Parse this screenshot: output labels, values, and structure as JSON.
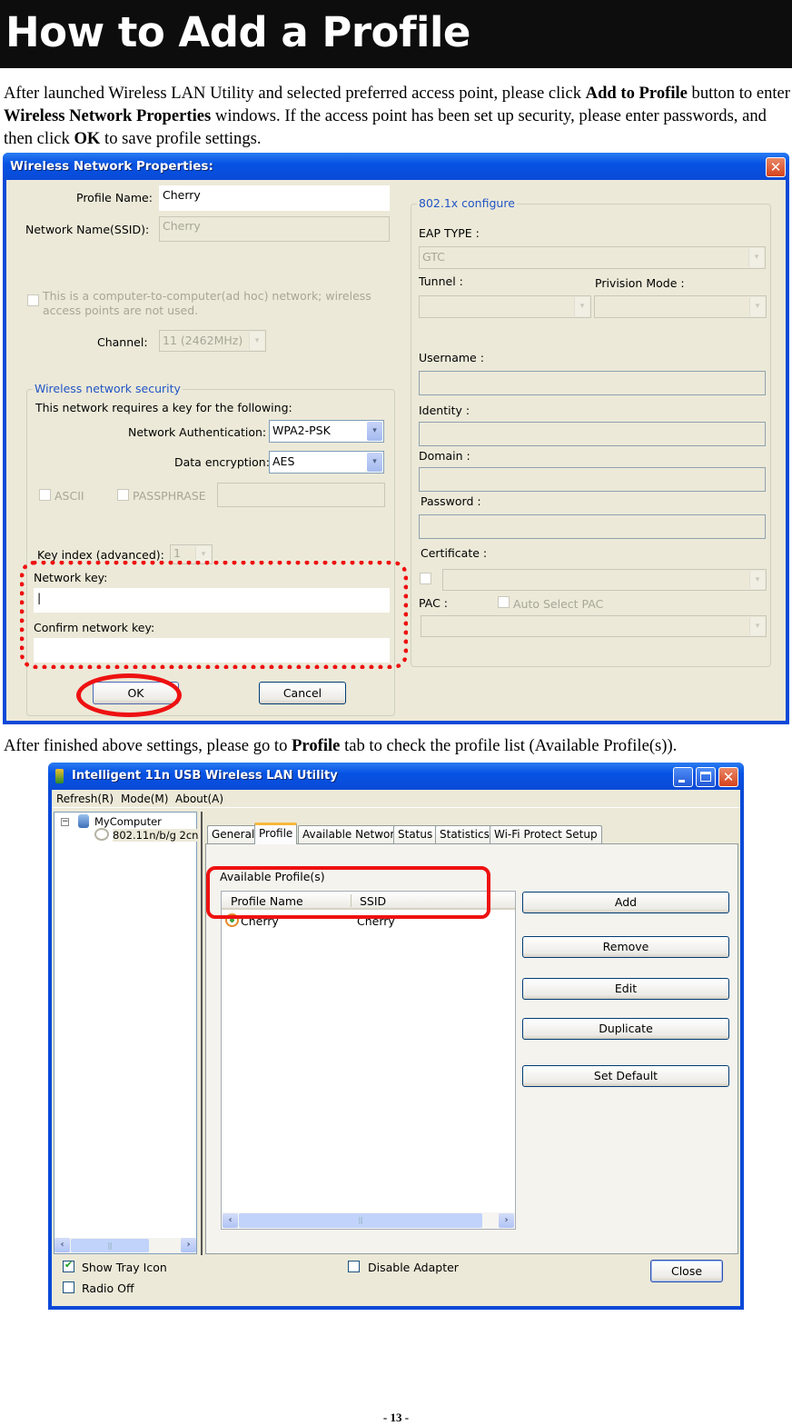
{
  "page": {
    "heading": "How to Add a Profile",
    "intro": {
      "t1": "After launched Wireless LAN Utility and selected preferred access point, please click ",
      "b1": "Add to Profile",
      "t2": " button to enter ",
      "b2": "Wireless Network Properties",
      "t3": " windows. If the access point has been set up security, please enter passwords, and then click ",
      "b3": "OK",
      "t4": " to save profile settings."
    },
    "second": {
      "t1": "After finished above settings, please go to ",
      "b1": "Profile",
      "t2": " tab to check the profile list (Available Profile(s))."
    },
    "page_number": "- 13 -"
  },
  "dialog1": {
    "title": "Wireless Network Properties:",
    "close_glyph": "✕",
    "profile_name_label": "Profile Name:",
    "profile_name_value": "Cherry",
    "ssid_label": "Network Name(SSID):",
    "ssid_value": "Cherry",
    "adhoc_label_line1": "This is a computer-to-computer(ad hoc) network; wireless",
    "adhoc_label_line2": "access points are not used.",
    "channel_label": "Channel:",
    "channel_value": "11 (2462MHz)",
    "security_group": {
      "title": "Wireless network security",
      "requires_text": "This network requires a key for the following:",
      "auth_label": "Network Authentication:",
      "auth_value": "WPA2-PSK",
      "enc_label": "Data encryption:",
      "enc_value": "AES",
      "ascii_label": "ASCII",
      "passphrase_label": "PASSPHRASE",
      "passphrase_value": "",
      "key_index_label": "Key index (advanced):",
      "key_index_value": "1",
      "network_key_label": "Network key:",
      "network_key_value": "|",
      "confirm_key_label": "Confirm network key:",
      "confirm_key_value": ""
    },
    "dot1x_group": {
      "title": "802.1x configure",
      "eap_label": "EAP TYPE :",
      "eap_value": "GTC",
      "tunnel_label": "Tunnel :",
      "tunnel_value": "",
      "provision_label": "Privision Mode :",
      "provision_value": "",
      "username_label": "Username :",
      "identity_label": "Identity :",
      "domain_label": "Domain :",
      "password_label": "Password :",
      "certificate_label": "Certificate :",
      "pac_label": "PAC :",
      "auto_pac_label": "Auto Select PAC"
    },
    "ok_label": "OK",
    "cancel_label": "Cancel",
    "dropdown_glyph": "▾"
  },
  "dialog2": {
    "title": "Intelligent 11n USB Wireless LAN Utility",
    "menu": [
      "Refresh(R)",
      "Mode(M)",
      "About(A)"
    ],
    "tree": {
      "root": "MyComputer",
      "child": "802.11n/b/g 2cn"
    },
    "tabs": [
      "General",
      "Profile",
      "Available Network",
      "Status",
      "Statistics",
      "Wi-Fi Protect Setup"
    ],
    "active_tab": "Profile",
    "available_label": "Available Profile(s)",
    "columns": [
      "Profile Name",
      "SSID"
    ],
    "rows": [
      {
        "name": "Cherry",
        "ssid": "Cherry"
      }
    ],
    "buttons": [
      "Add",
      "Remove",
      "Edit",
      "Duplicate",
      "Set Default"
    ],
    "show_tray_label": "Show Tray Icon",
    "show_tray_checked": true,
    "radio_off_label": "Radio Off",
    "radio_off_checked": false,
    "disable_adapter_label": "Disable Adapter",
    "disable_adapter_checked": false,
    "close_label": "Close",
    "scroll_left": "‹",
    "scroll_right": "›",
    "scroll_grip": "|||"
  },
  "colors": {
    "annotation_red": "#ee1111",
    "xp_blue": "#0a49d8",
    "dialog_bg": "#ece9d8"
  }
}
